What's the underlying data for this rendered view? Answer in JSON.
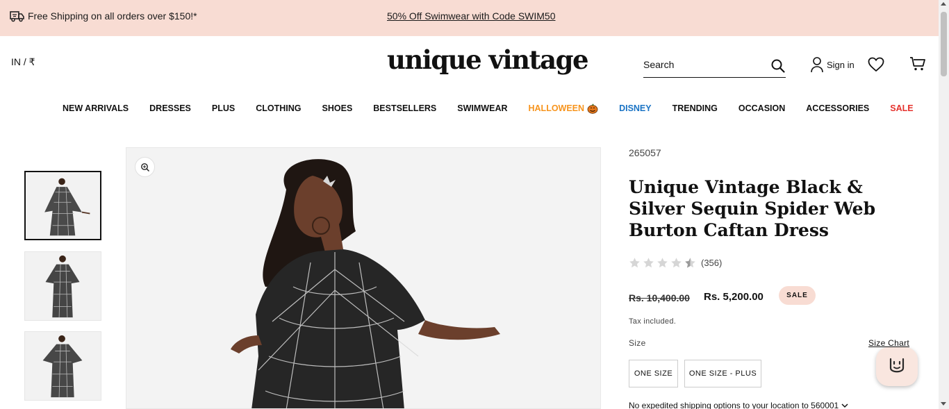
{
  "announcement": {
    "shipping_text": "Free Shipping on all orders over $150!*",
    "promo_link": "50% Off Swimwear with Code SWIM50",
    "background": "#f8dcd3"
  },
  "header": {
    "locale": "IN / ₹",
    "logo": "unique vintage",
    "search_placeholder": "Search",
    "signin_label": "Sign in"
  },
  "nav": {
    "items": [
      "NEW ARRIVALS",
      "DRESSES",
      "PLUS",
      "CLOTHING",
      "SHOES",
      "BESTSELLERS",
      "SWIMWEAR",
      "HALLOWEEN",
      "DISNEY",
      "TRENDING",
      "OCCASION",
      "ACCESSORIES",
      "SALE"
    ],
    "colors": {
      "halloween": "#f7941d",
      "disney": "#1b74c5",
      "sale": "#e5322d"
    }
  },
  "gallery": {
    "thumbnail_count": 3,
    "selected_index": 0
  },
  "product": {
    "sku": "265057",
    "title": "Unique Vintage Black & Silver Sequin Spider Web Burton Caftan Dress",
    "rating": 4.5,
    "review_count": "(356)",
    "price_original": "Rs. 10,400.00",
    "price_sale": "Rs. 5,200.00",
    "sale_badge": "SALE",
    "tax_note": "Tax included.",
    "size_label": "Size",
    "size_chart_link": "Size Chart",
    "sizes": [
      "ONE SIZE",
      "ONE SIZE - PLUS"
    ],
    "shipping_note": "No expedited shipping options to your location to 560001"
  },
  "icons": {
    "shipping": "delivery-truck-icon",
    "search": "search-icon",
    "account": "user-icon",
    "wishlist": "heart-icon",
    "cart": "cart-icon",
    "zoom": "zoom-in-icon",
    "chat": "chat-smile-icon"
  }
}
